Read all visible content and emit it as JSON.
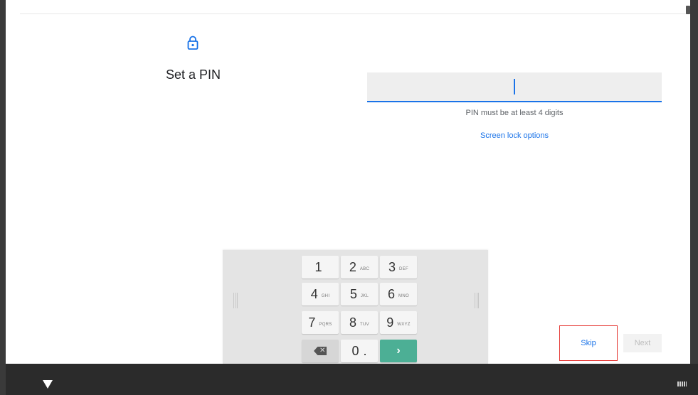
{
  "setup": {
    "title": "Set a PIN",
    "hint": "PIN must be at least 4 digits",
    "options_link": "Screen lock options",
    "pin_value": ""
  },
  "keypad": {
    "rows": [
      [
        {
          "digit": "1",
          "letters": ""
        },
        {
          "digit": "2",
          "letters": "ABC"
        },
        {
          "digit": "3",
          "letters": "DEF"
        }
      ],
      [
        {
          "digit": "4",
          "letters": "GHI"
        },
        {
          "digit": "5",
          "letters": "JKL"
        },
        {
          "digit": "6",
          "letters": "MNO"
        }
      ],
      [
        {
          "digit": "7",
          "letters": "PQRS"
        },
        {
          "digit": "8",
          "letters": "TUV"
        },
        {
          "digit": "9",
          "letters": "WXYZ"
        }
      ]
    ],
    "zero": {
      "digit": "0",
      "extra": "."
    },
    "backspace_icon": "backspace-icon",
    "enter_icon": "arrow-right-icon"
  },
  "actions": {
    "skip_label": "Skip",
    "next_label": "Next"
  },
  "icons": {
    "lock": "lock-icon",
    "back": "back-triangle-icon",
    "keyboard": "keyboard-icon"
  },
  "colors": {
    "accent": "#1a73e8",
    "highlight_border": "#e53935",
    "enter_key": "#4caf95"
  }
}
